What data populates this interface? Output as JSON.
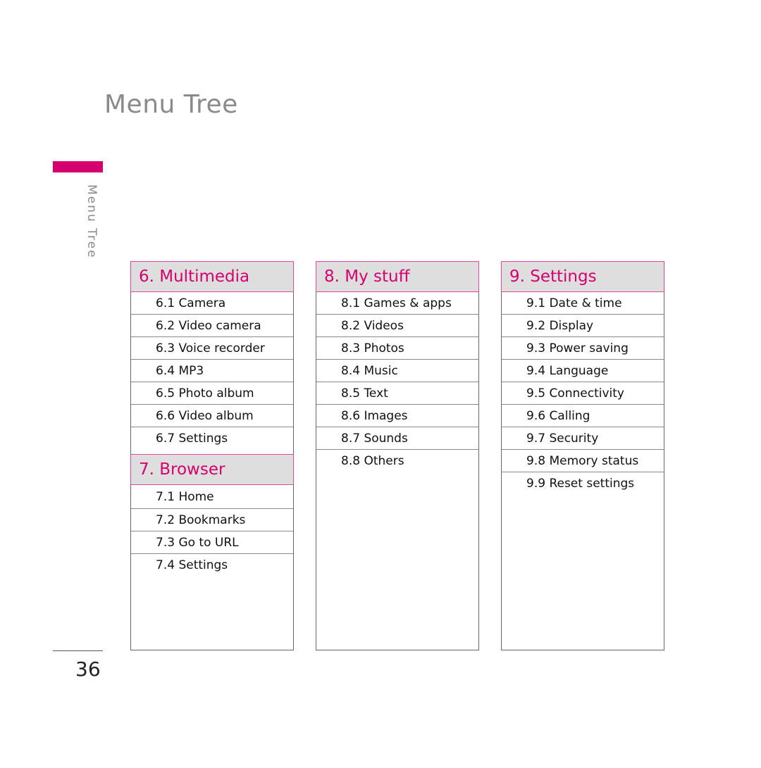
{
  "page": {
    "title": "Menu Tree",
    "side_label": "Menu Tree",
    "page_number": "36",
    "accent_color": "#d4006f",
    "header_fill": "#dedede"
  },
  "columns": [
    {
      "sections": [
        {
          "title": "6. Multimedia",
          "items": [
            "6.1 Camera",
            "6.2 Video camera",
            "6.3 Voice recorder",
            "6.4 MP3",
            "6.5 Photo album",
            "6.6 Video album",
            "6.7 Settings"
          ]
        },
        {
          "title": "7. Browser",
          "items": [
            "7.1 Home",
            "7.2 Bookmarks",
            "7.3 Go to URL",
            "7.4 Settings"
          ]
        }
      ]
    },
    {
      "sections": [
        {
          "title": "8. My stuff",
          "items": [
            "8.1 Games & apps",
            "8.2 Videos",
            "8.3 Photos",
            "8.4 Music",
            "8.5 Text",
            "8.6 Images",
            "8.7 Sounds",
            "8.8 Others"
          ]
        }
      ]
    },
    {
      "sections": [
        {
          "title": "9. Settings",
          "items": [
            "9.1 Date & time",
            "9.2 Display",
            "9.3 Power saving",
            "9.4 Language",
            "9.5 Connectivity",
            "9.6 Calling",
            "9.7 Security",
            "9.8 Memory status",
            "9.9 Reset settings"
          ]
        }
      ]
    }
  ]
}
